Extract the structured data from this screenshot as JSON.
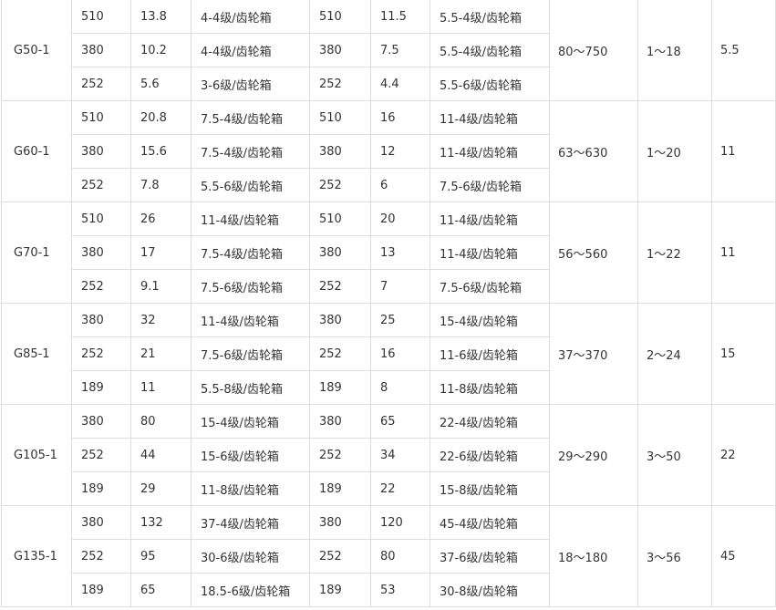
{
  "table": {
    "groups": [
      {
        "model": "G50-1",
        "speed_range": "80～750",
        "range_b": "1～18",
        "value_c": "5.5",
        "rows": [
          [
            "510",
            "13.8",
            "4-4级/齿轮箱",
            "510",
            "11.5",
            "5.5-4级/齿轮箱"
          ],
          [
            "380",
            "10.2",
            "4-4级/齿轮箱",
            "380",
            "7.5",
            "5.5-4级/齿轮箱"
          ],
          [
            "252",
            "5.6",
            "3-6级/齿轮箱",
            "252",
            "4.4",
            "5.5-6级/齿轮箱"
          ]
        ]
      },
      {
        "model": "G60-1",
        "speed_range": "63～630",
        "range_b": "1～20",
        "value_c": "11",
        "rows": [
          [
            "510",
            "20.8",
            "7.5-4级/齿轮箱",
            "510",
            "16",
            "11-4级/齿轮箱"
          ],
          [
            "380",
            "15.6",
            "7.5-4级/齿轮箱",
            "380",
            "12",
            "11-4级/齿轮箱"
          ],
          [
            "252",
            "7.8",
            "5.5-6级/齿轮箱",
            "252",
            "6",
            "7.5-6级/齿轮箱"
          ]
        ]
      },
      {
        "model": "G70-1",
        "speed_range": "56～560",
        "range_b": "1～22",
        "value_c": "11",
        "rows": [
          [
            "510",
            "26",
            "11-4级/齿轮箱",
            "510",
            "20",
            "11-4级/齿轮箱"
          ],
          [
            "380",
            "17",
            "7.5-4级/齿轮箱",
            "380",
            "13",
            "11-4级/齿轮箱"
          ],
          [
            "252",
            "9.1",
            "7.5-6级/齿轮箱",
            "252",
            "7",
            "7.5-6级/齿轮箱"
          ]
        ]
      },
      {
        "model": "G85-1",
        "speed_range": "37～370",
        "range_b": "2～24",
        "value_c": "15",
        "rows": [
          [
            "380",
            "32",
            "11-4级/齿轮箱",
            "380",
            "25",
            "15-4级/齿轮箱"
          ],
          [
            "252",
            "21",
            "7.5-6级/齿轮箱",
            "252",
            "16",
            "11-6级/齿轮箱"
          ],
          [
            "189",
            "11",
            "5.5-8级/齿轮箱",
            "189",
            "8",
            "11-8级/齿轮箱"
          ]
        ]
      },
      {
        "model": "G105-1",
        "speed_range": "29～290",
        "range_b": "3～50",
        "value_c": "22",
        "rows": [
          [
            "380",
            "80",
            "15-4级/齿轮箱",
            "380",
            "65",
            "22-4级/齿轮箱"
          ],
          [
            "252",
            "44",
            "15-6级/齿轮箱",
            "252",
            "34",
            "22-6级/齿轮箱"
          ],
          [
            "189",
            "29",
            "11-8级/齿轮箱",
            "189",
            "22",
            "15-8级/齿轮箱"
          ]
        ]
      },
      {
        "model": "G135-1",
        "speed_range": "18～180",
        "range_b": "3～56",
        "value_c": "45",
        "rows": [
          [
            "380",
            "132",
            "37-4级/齿轮箱",
            "380",
            "120",
            "45-4级/齿轮箱"
          ],
          [
            "252",
            "95",
            "30-6级/齿轮箱",
            "252",
            "80",
            "37-6级/齿轮箱"
          ],
          [
            "189",
            "65",
            "18.5-6级/齿轮箱",
            "189",
            "53",
            "30-8级/齿轮箱"
          ]
        ]
      }
    ]
  }
}
